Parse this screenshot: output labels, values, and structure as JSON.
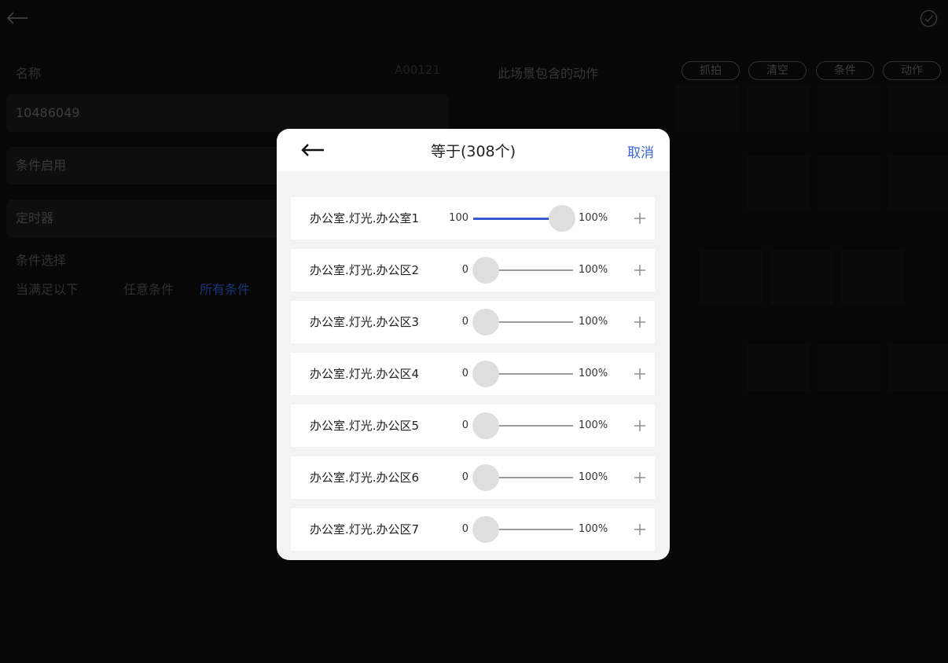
{
  "form": {
    "name_label": "名称",
    "name_value": "10486049",
    "code": "A00121",
    "enable_label": "条件启用",
    "timer_label": "定时器",
    "cond_select_label": "条件选择",
    "when_label": "当满足以下",
    "any_label": "任意条件",
    "all_label": "所有条件"
  },
  "scene": {
    "title": "此场景包含的动作",
    "buttons": [
      "抓拍",
      "清空",
      "条件",
      "动作"
    ]
  },
  "modal": {
    "title": "等于(308个)",
    "cancel": "取消",
    "rows": [
      {
        "name": "办公室.灯光.办公室1",
        "value": "100",
        "max": "100%",
        "percent": 100
      },
      {
        "name": "办公室.灯光.办公区2",
        "value": "0",
        "max": "100%",
        "percent": 0
      },
      {
        "name": "办公室.灯光.办公区3",
        "value": "0",
        "max": "100%",
        "percent": 0
      },
      {
        "name": "办公室.灯光.办公区4",
        "value": "0",
        "max": "100%",
        "percent": 0
      },
      {
        "name": "办公室.灯光.办公区5",
        "value": "0",
        "max": "100%",
        "percent": 0
      },
      {
        "name": "办公室.灯光.办公区6",
        "value": "0",
        "max": "100%",
        "percent": 0
      },
      {
        "name": "办公室.灯光.办公区7",
        "value": "0",
        "max": "100%",
        "percent": 0
      }
    ]
  },
  "colors": {
    "accent": "#3763d7",
    "all_conditions": "#2a4fb8"
  },
  "icons": {
    "back": "back-arrow-icon",
    "confirm": "check-circle-icon",
    "plus": "plus-icon"
  }
}
